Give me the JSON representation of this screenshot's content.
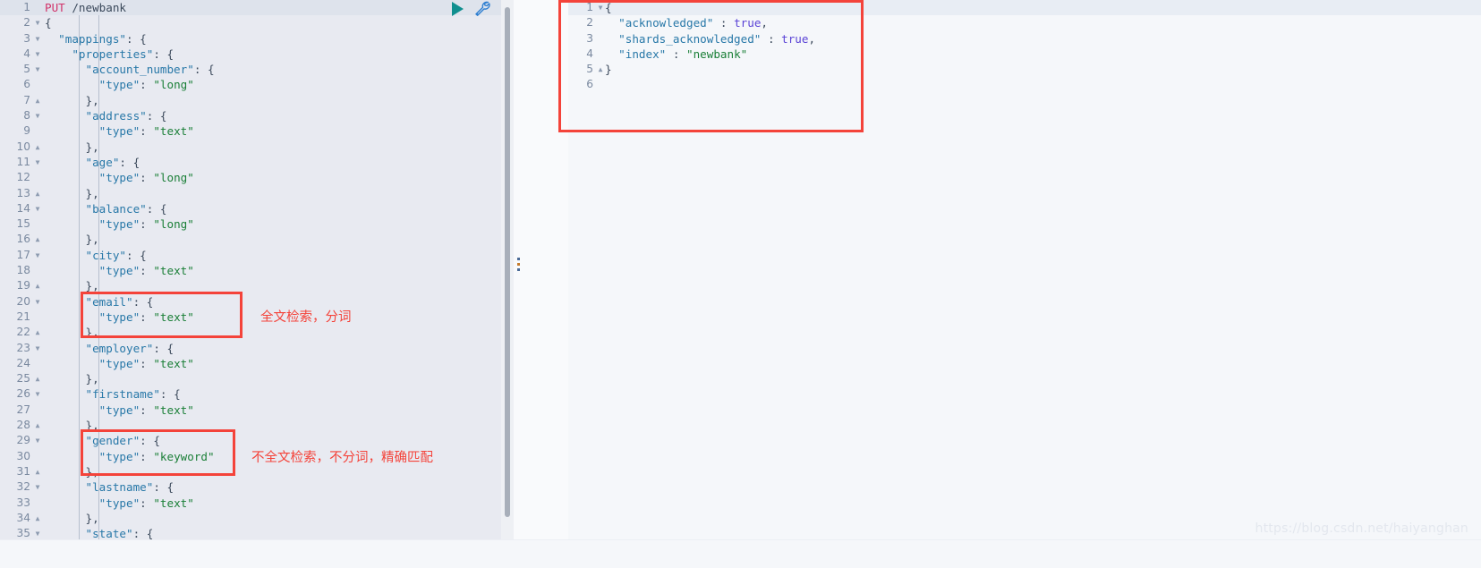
{
  "toolbar": {
    "play_label": "send-request",
    "wrench_label": "settings-wrench",
    "accent_color": "#108f8f"
  },
  "request_editor": {
    "name": "request-console",
    "active_line": 1,
    "lines": [
      {
        "n": 1,
        "fold": "",
        "indent": 0,
        "tokens": [
          {
            "t": "PUT",
            "c": "k-method"
          },
          {
            "t": " /newbank",
            "c": "k-path"
          }
        ]
      },
      {
        "n": 2,
        "fold": "down",
        "indent": 0,
        "tokens": [
          {
            "t": "{",
            "c": "k-punc"
          }
        ]
      },
      {
        "n": 3,
        "fold": "down",
        "indent": 1,
        "tokens": [
          {
            "t": "\"mappings\"",
            "c": "k-key"
          },
          {
            "t": ": {",
            "c": "k-punc"
          }
        ]
      },
      {
        "n": 4,
        "fold": "down",
        "indent": 2,
        "tokens": [
          {
            "t": "\"properties\"",
            "c": "k-key"
          },
          {
            "t": ": {",
            "c": "k-punc"
          }
        ]
      },
      {
        "n": 5,
        "fold": "down",
        "indent": 3,
        "tokens": [
          {
            "t": "\"account_number\"",
            "c": "k-key"
          },
          {
            "t": ": {",
            "c": "k-punc"
          }
        ]
      },
      {
        "n": 6,
        "fold": "",
        "indent": 4,
        "tokens": [
          {
            "t": "\"type\"",
            "c": "k-key"
          },
          {
            "t": ": ",
            "c": "k-punc"
          },
          {
            "t": "\"long\"",
            "c": "k-str"
          }
        ]
      },
      {
        "n": 7,
        "fold": "up",
        "indent": 3,
        "tokens": [
          {
            "t": "},",
            "c": "k-punc"
          }
        ]
      },
      {
        "n": 8,
        "fold": "down",
        "indent": 3,
        "tokens": [
          {
            "t": "\"address\"",
            "c": "k-key"
          },
          {
            "t": ": {",
            "c": "k-punc"
          }
        ]
      },
      {
        "n": 9,
        "fold": "",
        "indent": 4,
        "tokens": [
          {
            "t": "\"type\"",
            "c": "k-key"
          },
          {
            "t": ": ",
            "c": "k-punc"
          },
          {
            "t": "\"text\"",
            "c": "k-str"
          }
        ]
      },
      {
        "n": 10,
        "fold": "up",
        "indent": 3,
        "tokens": [
          {
            "t": "},",
            "c": "k-punc"
          }
        ]
      },
      {
        "n": 11,
        "fold": "down",
        "indent": 3,
        "tokens": [
          {
            "t": "\"age\"",
            "c": "k-key"
          },
          {
            "t": ": {",
            "c": "k-punc"
          }
        ]
      },
      {
        "n": 12,
        "fold": "",
        "indent": 4,
        "tokens": [
          {
            "t": "\"type\"",
            "c": "k-key"
          },
          {
            "t": ": ",
            "c": "k-punc"
          },
          {
            "t": "\"long\"",
            "c": "k-str"
          }
        ]
      },
      {
        "n": 13,
        "fold": "up",
        "indent": 3,
        "tokens": [
          {
            "t": "},",
            "c": "k-punc"
          }
        ]
      },
      {
        "n": 14,
        "fold": "down",
        "indent": 3,
        "tokens": [
          {
            "t": "\"balance\"",
            "c": "k-key"
          },
          {
            "t": ": {",
            "c": "k-punc"
          }
        ]
      },
      {
        "n": 15,
        "fold": "",
        "indent": 4,
        "tokens": [
          {
            "t": "\"type\"",
            "c": "k-key"
          },
          {
            "t": ": ",
            "c": "k-punc"
          },
          {
            "t": "\"long\"",
            "c": "k-str"
          }
        ]
      },
      {
        "n": 16,
        "fold": "up",
        "indent": 3,
        "tokens": [
          {
            "t": "},",
            "c": "k-punc"
          }
        ]
      },
      {
        "n": 17,
        "fold": "down",
        "indent": 3,
        "tokens": [
          {
            "t": "\"city\"",
            "c": "k-key"
          },
          {
            "t": ": {",
            "c": "k-punc"
          }
        ]
      },
      {
        "n": 18,
        "fold": "",
        "indent": 4,
        "tokens": [
          {
            "t": "\"type\"",
            "c": "k-key"
          },
          {
            "t": ": ",
            "c": "k-punc"
          },
          {
            "t": "\"text\"",
            "c": "k-str"
          }
        ]
      },
      {
        "n": 19,
        "fold": "up",
        "indent": 3,
        "tokens": [
          {
            "t": "},",
            "c": "k-punc"
          }
        ]
      },
      {
        "n": 20,
        "fold": "down",
        "indent": 3,
        "tokens": [
          {
            "t": "\"email\"",
            "c": "k-key"
          },
          {
            "t": ": {",
            "c": "k-punc"
          }
        ]
      },
      {
        "n": 21,
        "fold": "",
        "indent": 4,
        "tokens": [
          {
            "t": "\"type\"",
            "c": "k-key"
          },
          {
            "t": ": ",
            "c": "k-punc"
          },
          {
            "t": "\"text\"",
            "c": "k-str"
          }
        ]
      },
      {
        "n": 22,
        "fold": "up",
        "indent": 3,
        "tokens": [
          {
            "t": "},",
            "c": "k-punc"
          }
        ]
      },
      {
        "n": 23,
        "fold": "down",
        "indent": 3,
        "tokens": [
          {
            "t": "\"employer\"",
            "c": "k-key"
          },
          {
            "t": ": {",
            "c": "k-punc"
          }
        ]
      },
      {
        "n": 24,
        "fold": "",
        "indent": 4,
        "tokens": [
          {
            "t": "\"type\"",
            "c": "k-key"
          },
          {
            "t": ": ",
            "c": "k-punc"
          },
          {
            "t": "\"text\"",
            "c": "k-str"
          }
        ]
      },
      {
        "n": 25,
        "fold": "up",
        "indent": 3,
        "tokens": [
          {
            "t": "},",
            "c": "k-punc"
          }
        ]
      },
      {
        "n": 26,
        "fold": "down",
        "indent": 3,
        "tokens": [
          {
            "t": "\"firstname\"",
            "c": "k-key"
          },
          {
            "t": ": {",
            "c": "k-punc"
          }
        ]
      },
      {
        "n": 27,
        "fold": "",
        "indent": 4,
        "tokens": [
          {
            "t": "\"type\"",
            "c": "k-key"
          },
          {
            "t": ": ",
            "c": "k-punc"
          },
          {
            "t": "\"text\"",
            "c": "k-str"
          }
        ]
      },
      {
        "n": 28,
        "fold": "up",
        "indent": 3,
        "tokens": [
          {
            "t": "},",
            "c": "k-punc"
          }
        ]
      },
      {
        "n": 29,
        "fold": "down",
        "indent": 3,
        "tokens": [
          {
            "t": "\"gender\"",
            "c": "k-key"
          },
          {
            "t": ": {",
            "c": "k-punc"
          }
        ]
      },
      {
        "n": 30,
        "fold": "",
        "indent": 4,
        "tokens": [
          {
            "t": "\"type\"",
            "c": "k-key"
          },
          {
            "t": ": ",
            "c": "k-punc"
          },
          {
            "t": "\"keyword\"",
            "c": "k-str"
          }
        ]
      },
      {
        "n": 31,
        "fold": "up",
        "indent": 3,
        "tokens": [
          {
            "t": "},",
            "c": "k-punc"
          }
        ]
      },
      {
        "n": 32,
        "fold": "down",
        "indent": 3,
        "tokens": [
          {
            "t": "\"lastname\"",
            "c": "k-key"
          },
          {
            "t": ": {",
            "c": "k-punc"
          }
        ]
      },
      {
        "n": 33,
        "fold": "",
        "indent": 4,
        "tokens": [
          {
            "t": "\"type\"",
            "c": "k-key"
          },
          {
            "t": ": ",
            "c": "k-punc"
          },
          {
            "t": "\"text\"",
            "c": "k-str"
          }
        ]
      },
      {
        "n": 34,
        "fold": "up",
        "indent": 3,
        "tokens": [
          {
            "t": "},",
            "c": "k-punc"
          }
        ]
      },
      {
        "n": 35,
        "fold": "down",
        "indent": 3,
        "tokens": [
          {
            "t": "\"state\"",
            "c": "k-key"
          },
          {
            "t": ": {",
            "c": "k-punc"
          }
        ]
      }
    ]
  },
  "response_editor": {
    "name": "response-output",
    "active_line": 1,
    "lines": [
      {
        "n": 1,
        "fold": "down",
        "indent": 0,
        "tokens": [
          {
            "t": "{",
            "c": "k-punc"
          }
        ]
      },
      {
        "n": 2,
        "fold": "",
        "indent": 1,
        "tokens": [
          {
            "t": "\"acknowledged\"",
            "c": "k-key"
          },
          {
            "t": " : ",
            "c": "k-punc"
          },
          {
            "t": "true",
            "c": "k-bool"
          },
          {
            "t": ",",
            "c": "k-punc"
          }
        ]
      },
      {
        "n": 3,
        "fold": "",
        "indent": 1,
        "tokens": [
          {
            "t": "\"shards_acknowledged\"",
            "c": "k-key"
          },
          {
            "t": " : ",
            "c": "k-punc"
          },
          {
            "t": "true",
            "c": "k-bool"
          },
          {
            "t": ",",
            "c": "k-punc"
          }
        ]
      },
      {
        "n": 4,
        "fold": "",
        "indent": 1,
        "tokens": [
          {
            "t": "\"index\"",
            "c": "k-key"
          },
          {
            "t": " : ",
            "c": "k-punc"
          },
          {
            "t": "\"newbank\"",
            "c": "k-str"
          }
        ]
      },
      {
        "n": 5,
        "fold": "up",
        "indent": 0,
        "tokens": [
          {
            "t": "}",
            "c": "k-punc"
          }
        ]
      },
      {
        "n": 6,
        "fold": "",
        "indent": 0,
        "tokens": [
          {
            "t": "",
            "c": "k-punc"
          }
        ]
      }
    ]
  },
  "annotations": {
    "color": "#f4433a",
    "email_note": "全文检索，分词",
    "gender_note": "不全文检索，不分词，精确匹配"
  },
  "watermark": {
    "text": "https://blog.csdn.net/haiyanghan"
  }
}
